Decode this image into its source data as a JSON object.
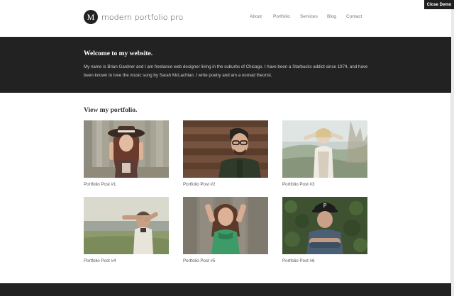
{
  "close_demo_label": "Close Demo",
  "header": {
    "logo_letter": "M",
    "site_title": "modern portfolio pro",
    "nav": [
      "About",
      "Portfolio",
      "Services",
      "Blog",
      "Contact"
    ]
  },
  "welcome": {
    "title": "Welcome to my website.",
    "text": "My name is Brian Gardner and I am freelance web designer living in the suburbs of Chicago. I have been a Starbucks addict since 1974, and have been known to love the music sung by Sarah McLachlan. I write poetry and am a nomad theorist."
  },
  "portfolio": {
    "title": "View my portfolio.",
    "posts": [
      {
        "caption": "Portfolio Post #1",
        "photo": "woman-with-hat-photo"
      },
      {
        "caption": "Portfolio Post #2",
        "photo": "man-with-glasses-photo"
      },
      {
        "caption": "Portfolio Post #3",
        "photo": "woman-in-field-photo"
      },
      {
        "caption": "Portfolio Post #4",
        "photo": "man-at-lake-photo"
      },
      {
        "caption": "Portfolio Post #5",
        "photo": "woman-green-top-photo"
      },
      {
        "caption": "Portfolio Post #6",
        "photo": "man-with-cap-photo"
      }
    ]
  },
  "colors": {
    "dark_band": "#222222",
    "page_bg": "#ffffff",
    "caption_text": "#555555"
  }
}
